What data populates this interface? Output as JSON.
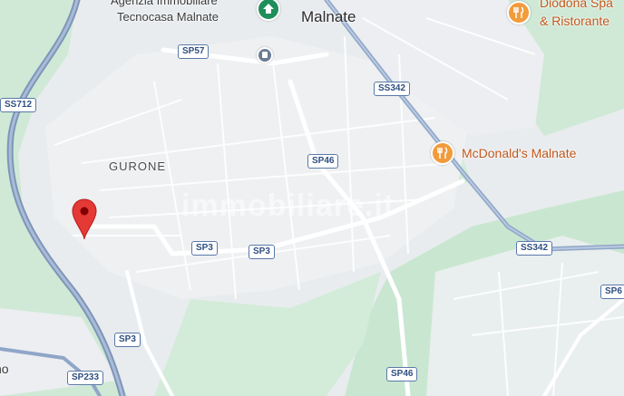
{
  "map": {
    "places": {
      "town": "Malnate",
      "area": "GURONE"
    },
    "pois": {
      "agency_line1": "Agenzia Immobiliare",
      "agency_line2": "Tecnocasa Malnate",
      "mcdonalds": "McDonald's Malnate",
      "diodona_line1": "Diodona Spa",
      "diodona_line2": "& Ristorante",
      "partial_left": "no"
    },
    "roads": {
      "sp57": "SP57",
      "ss712": "SS712",
      "ss342_top": "SS342",
      "sp46_top": "SP46",
      "sp3_a": "SP3",
      "sp3_b": "SP3",
      "ss342_right": "SS342",
      "sp6_partial": "SP6",
      "sp3_bottom": "SP3",
      "sp233": "SP233",
      "sp46_bottom": "SP46"
    },
    "watermark": "immobiliare.it",
    "icons": {
      "marker": "map-pin-icon",
      "restaurant": "restaurant-icon",
      "shopping": "shopping-bag-icon",
      "transit": "train-station-icon"
    }
  }
}
